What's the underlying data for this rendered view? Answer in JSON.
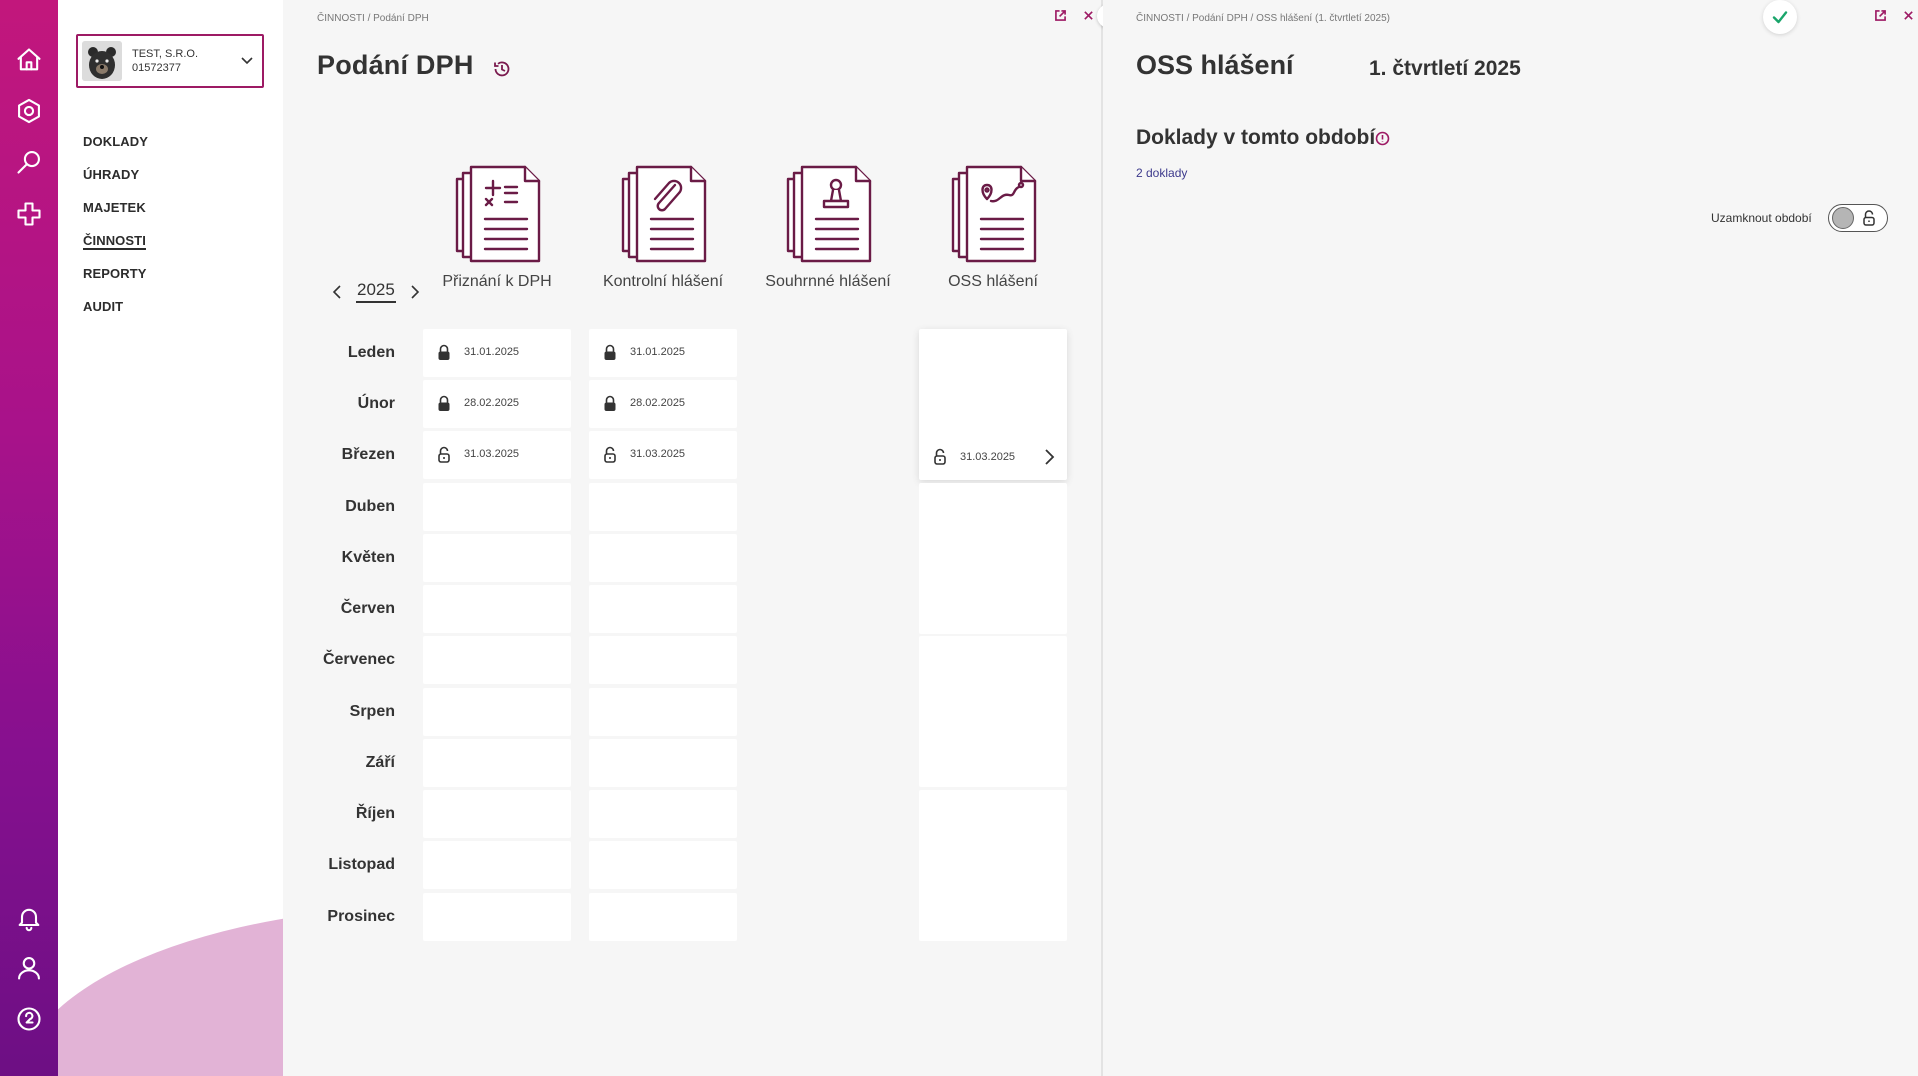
{
  "company": {
    "name": "TEST, S.R.O.",
    "ico": "01572377"
  },
  "nav": [
    "DOKLADY",
    "ÚHRADY",
    "MAJETEK",
    "ČINNOSTI",
    "REPORTY",
    "AUDIT"
  ],
  "nav_active": "ČINNOSTI",
  "rail_icons": [
    "home-icon",
    "settings-icon",
    "search-icon",
    "plus-icon",
    "bell-icon",
    "user-icon",
    "help-icon"
  ],
  "left_panel": {
    "breadcrumb": [
      "ČINNOSTI",
      "Podání DPH"
    ],
    "title": "Podání DPH",
    "year": "2025",
    "columns": [
      "Přiznání k DPH",
      "Kontrolní hlášení",
      "Souhrnné hlášení",
      "OSS hlášení"
    ],
    "months": [
      "Leden",
      "Únor",
      "Březen",
      "Duben",
      "Květen",
      "Červen",
      "Červenec",
      "Srpen",
      "Září",
      "Říjen",
      "Listopad",
      "Prosinec"
    ],
    "priznani": [
      {
        "date": "31.01.2025",
        "locked": true
      },
      {
        "date": "28.02.2025",
        "locked": true
      },
      {
        "date": "31.03.2025",
        "locked": false
      }
    ],
    "kontrolni": [
      {
        "date": "31.01.2025",
        "locked": true
      },
      {
        "date": "28.02.2025",
        "locked": true
      },
      {
        "date": "31.03.2025",
        "locked": false
      }
    ],
    "oss": {
      "date": "31.03.2025",
      "locked": false
    }
  },
  "right_panel": {
    "breadcrumb": [
      "ČINNOSTI",
      "Podání DPH",
      "OSS hlášení (1. čtvrtletí 2025)"
    ],
    "title": "OSS hlášení",
    "period": "1. čtvrtletí 2025",
    "section_title": "Doklady v tomto období",
    "docs_link": "2 doklady",
    "lock_label": "Uzamknout období",
    "lock_toggle_on": false
  },
  "colors": {
    "brand": "#9d1a64",
    "icon_dark": "#6a1b46",
    "success": "#1aa56b",
    "link": "#3d3a8c"
  }
}
